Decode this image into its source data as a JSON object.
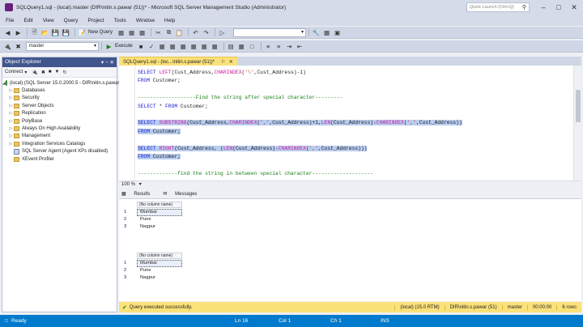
{
  "window": {
    "title": "SQLQuery1.sql - (local).master (DIR\\nitin.s.pawar (51))* - Microsoft SQL Server Management Studio (Administrator)",
    "quick_launch_placeholder": "Quick Launch (Ctrl+Q)"
  },
  "menu": [
    "File",
    "Edit",
    "View",
    "Query",
    "Project",
    "Tools",
    "Window",
    "Help"
  ],
  "toolbar": {
    "new_query": "New Query",
    "database": "master",
    "execute": "Execute"
  },
  "object_explorer": {
    "title": "Object Explorer",
    "connect": "Connect",
    "root": "(local) (SQL Server 15.0.2000.5 - DIR\\nitin.s.pawar)",
    "items": [
      "Databases",
      "Security",
      "Server Objects",
      "Replication",
      "PolyBase",
      "Always On High Availability",
      "Management",
      "Integration Services Catalogs",
      "SQL Server Agent (Agent XPs disabled)",
      "XEvent Profiler"
    ]
  },
  "editor": {
    "tab_label": "SQLQuery1.sql - (loc...\\nitin.s.pawar (51))*",
    "lines": [
      {
        "parts": [
          {
            "t": "SELECT ",
            "c": "kw"
          },
          {
            "t": "LEFT",
            "c": "fn"
          },
          {
            "t": "(Cust_Address,",
            "c": ""
          },
          {
            "t": "CHARINDEX",
            "c": "fn"
          },
          {
            "t": "(",
            "c": ""
          },
          {
            "t": "'\\'",
            "c": "str"
          },
          {
            "t": ",Cust_Address)-1)",
            "c": ""
          }
        ]
      },
      {
        "parts": [
          {
            "t": "FROM ",
            "c": "kw"
          },
          {
            "t": "Customer;",
            "c": ""
          }
        ]
      },
      {
        "parts": [
          {
            "t": "",
            "c": ""
          }
        ]
      },
      {
        "parts": [
          {
            "t": "-------------------Find the string after special character---------",
            "c": "cm"
          }
        ]
      },
      {
        "parts": [
          {
            "t": "SELECT ",
            "c": "kw"
          },
          {
            "t": "* ",
            "c": ""
          },
          {
            "t": "FROM ",
            "c": "kw"
          },
          {
            "t": "Customer;",
            "c": ""
          }
        ]
      },
      {
        "parts": [
          {
            "t": "",
            "c": ""
          }
        ]
      },
      {
        "sel": true,
        "parts": [
          {
            "t": "SELECT ",
            "c": "kw"
          },
          {
            "t": "SUBSTRING",
            "c": "fn"
          },
          {
            "t": "(Cust_Address,",
            "c": ""
          },
          {
            "t": "CHARINDEX",
            "c": "fn"
          },
          {
            "t": "(",
            "c": ""
          },
          {
            "t": "','",
            "c": "str"
          },
          {
            "t": ",Cust_Address)+1,",
            "c": ""
          },
          {
            "t": "LEN",
            "c": "fn"
          },
          {
            "t": "(Cust_Address)-",
            "c": ""
          },
          {
            "t": "CHARINDEX",
            "c": "fn"
          },
          {
            "t": "(",
            "c": ""
          },
          {
            "t": "','",
            "c": "str"
          },
          {
            "t": ",Cust_Address))",
            "c": ""
          }
        ]
      },
      {
        "sel": true,
        "parts": [
          {
            "t": "FROM ",
            "c": "kw"
          },
          {
            "t": "Customer;",
            "c": ""
          }
        ]
      },
      {
        "parts": [
          {
            "t": "",
            "c": ""
          }
        ]
      },
      {
        "sel": true,
        "parts": [
          {
            "t": "SELECT ",
            "c": "kw"
          },
          {
            "t": "RIGHT",
            "c": "fn"
          },
          {
            "t": "(Cust_Address, (",
            "c": ""
          },
          {
            "t": "LEN",
            "c": "fn"
          },
          {
            "t": "(Cust_Address)-",
            "c": ""
          },
          {
            "t": "CHARINDEX",
            "c": "fn"
          },
          {
            "t": "(",
            "c": ""
          },
          {
            "t": "','",
            "c": "str"
          },
          {
            "t": ",Cust_Address)))",
            "c": ""
          }
        ]
      },
      {
        "sel": true,
        "parts": [
          {
            "t": "FROM ",
            "c": "kw"
          },
          {
            "t": "Customer;",
            "c": ""
          }
        ]
      },
      {
        "parts": [
          {
            "t": "",
            "c": ""
          }
        ]
      },
      {
        "parts": [
          {
            "t": "-------------find the string in between special character--------------------",
            "c": "cm"
          }
        ]
      }
    ],
    "zoom": "100 %"
  },
  "results": {
    "tab_results": "Results",
    "tab_messages": "Messages",
    "grids": [
      {
        "header": "(No column name)",
        "rows": [
          {
            "n": "1",
            "v": "Mumbai"
          },
          {
            "n": "2",
            "v": "Pune"
          },
          {
            "n": "3",
            "v": "Nagpur"
          }
        ]
      },
      {
        "header": "(No column name)",
        "rows": [
          {
            "n": "1",
            "v": "Mumbai"
          },
          {
            "n": "2",
            "v": "Pune"
          },
          {
            "n": "3",
            "v": "Nagpur"
          }
        ]
      }
    ]
  },
  "query_status": {
    "message": "Query executed successfully.",
    "server": "(local) (15.0 RTM)",
    "user": "DIR\\nitin.s.pawar (51)",
    "db": "master",
    "time": "00:00:00",
    "rows": "6 rows"
  },
  "statusbar": {
    "ready": "Ready",
    "ln": "Ln 16",
    "col": "Col 1",
    "ch": "Ch 1",
    "mode": "INS"
  }
}
